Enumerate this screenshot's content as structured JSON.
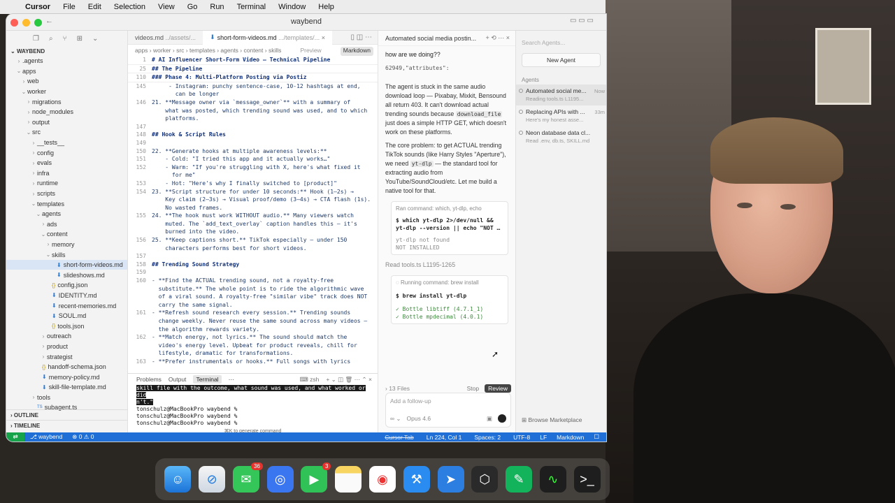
{
  "menubar": {
    "app": "Cursor",
    "items": [
      "File",
      "Edit",
      "Selection",
      "View",
      "Go",
      "Run",
      "Terminal",
      "Window",
      "Help"
    ]
  },
  "window": {
    "title": "waybend"
  },
  "explorer": {
    "root": "WAYBEND",
    "rows": [
      {
        "label": ".agents",
        "indent": 1,
        "type": "folder",
        "open": false
      },
      {
        "label": "apps",
        "indent": 1,
        "type": "folder",
        "open": true
      },
      {
        "label": "web",
        "indent": 2,
        "type": "folder",
        "open": false
      },
      {
        "label": "worker",
        "indent": 2,
        "type": "folder",
        "open": true
      },
      {
        "label": "migrations",
        "indent": 3,
        "type": "folder",
        "open": false
      },
      {
        "label": "node_modules",
        "indent": 3,
        "type": "folder",
        "open": false
      },
      {
        "label": "output",
        "indent": 3,
        "type": "folder",
        "open": false
      },
      {
        "label": "src",
        "indent": 3,
        "type": "folder",
        "open": true
      },
      {
        "label": "__tests__",
        "indent": 4,
        "type": "folder",
        "open": false
      },
      {
        "label": "config",
        "indent": 4,
        "type": "folder",
        "open": false
      },
      {
        "label": "evals",
        "indent": 4,
        "type": "folder",
        "open": false
      },
      {
        "label": "infra",
        "indent": 4,
        "type": "folder",
        "open": false
      },
      {
        "label": "runtime",
        "indent": 4,
        "type": "folder",
        "open": false
      },
      {
        "label": "scripts",
        "indent": 4,
        "type": "folder",
        "open": false
      },
      {
        "label": "templates",
        "indent": 4,
        "type": "folder",
        "open": true
      },
      {
        "label": "agents",
        "indent": 5,
        "type": "folder",
        "open": true
      },
      {
        "label": "ads",
        "indent": 6,
        "type": "folder",
        "open": false
      },
      {
        "label": "content",
        "indent": 6,
        "type": "folder",
        "open": true
      },
      {
        "label": "memory",
        "indent": 7,
        "type": "folder",
        "open": false
      },
      {
        "label": "skills",
        "indent": 7,
        "type": "folder",
        "open": true
      },
      {
        "label": "short-form-videos.md",
        "indent": 8,
        "type": "md",
        "selected": true
      },
      {
        "label": "slideshows.md",
        "indent": 8,
        "type": "md"
      },
      {
        "label": "config.json",
        "indent": 7,
        "type": "json"
      },
      {
        "label": "IDENTITY.md",
        "indent": 7,
        "type": "md"
      },
      {
        "label": "recent-memories.md",
        "indent": 7,
        "type": "md"
      },
      {
        "label": "SOUL.md",
        "indent": 7,
        "type": "md"
      },
      {
        "label": "tools.json",
        "indent": 7,
        "type": "json"
      },
      {
        "label": "outreach",
        "indent": 6,
        "type": "folder",
        "open": false
      },
      {
        "label": "product",
        "indent": 6,
        "type": "folder",
        "open": false
      },
      {
        "label": "strategist",
        "indent": 6,
        "type": "folder",
        "open": false
      },
      {
        "label": "handoff-schema.json",
        "indent": 5,
        "type": "json"
      },
      {
        "label": "memory-policy.md",
        "indent": 5,
        "type": "md"
      },
      {
        "label": "skill-file-template.md",
        "indent": 5,
        "type": "md"
      },
      {
        "label": "tools",
        "indent": 4,
        "type": "folder",
        "open": false
      },
      {
        "label": "subagent.ts",
        "indent": 4,
        "type": "ts"
      }
    ],
    "outline": "OUTLINE",
    "timeline": "TIMELINE"
  },
  "editor": {
    "tabs": [
      {
        "label": "videos.md",
        "path": "../assets/..."
      },
      {
        "label": "short-form-videos.md",
        "path": ".../templates/..."
      }
    ],
    "breadcrumb": [
      "apps",
      "worker",
      "src",
      "templates",
      "agents",
      "content",
      "skills"
    ],
    "preview": "Preview",
    "markdown": "Markdown",
    "lines": [
      {
        "n": "1",
        "t": "# AI Influencer Short-Form Video — Technical Pipeline",
        "cls": "h"
      },
      {
        "n": "25",
        "t": "## The Pipeline",
        "cls": "h"
      },
      {
        "n": "110",
        "t": "### Phase 4: Multi-Platform Posting via Postiz",
        "cls": "h"
      },
      {
        "n": "145",
        "t": "     - Instagram: punchy sentence-case, 10-12 hashtags at end,",
        "cls": ""
      },
      {
        "n": "",
        "t": "       can be longer",
        "cls": ""
      },
      {
        "n": "146",
        "t": "21. **Message owner via `message_owner`** with a summary of",
        "cls": ""
      },
      {
        "n": "",
        "t": "    what was posted, which trending sound was used, and to which",
        "cls": ""
      },
      {
        "n": "",
        "t": "    platforms.",
        "cls": ""
      },
      {
        "n": "147",
        "t": "",
        "cls": ""
      },
      {
        "n": "148",
        "t": "## Hook & Script Rules",
        "cls": "h"
      },
      {
        "n": "149",
        "t": "",
        "cls": ""
      },
      {
        "n": "150",
        "t": "22. **Generate hooks at multiple awareness levels:**",
        "cls": ""
      },
      {
        "n": "151",
        "t": "    - Cold: \"I tried this app and it actually works…\"",
        "cls": ""
      },
      {
        "n": "152",
        "t": "    - Warm: \"If you're struggling with X, here's what fixed it",
        "cls": ""
      },
      {
        "n": "",
        "t": "      for me\"",
        "cls": ""
      },
      {
        "n": "153",
        "t": "    - Hot: \"Here's why I finally switched to [product]\"",
        "cls": ""
      },
      {
        "n": "154",
        "t": "23. **Script structure for under 10 seconds:** Hook (1–2s) →",
        "cls": ""
      },
      {
        "n": "",
        "t": "    Key claim (2–3s) → Visual proof/demo (3–4s) → CTA flash (1s).",
        "cls": ""
      },
      {
        "n": "",
        "t": "    No wasted frames.",
        "cls": ""
      },
      {
        "n": "155",
        "t": "24. **The hook must work WITHOUT audio.** Many viewers watch",
        "cls": ""
      },
      {
        "n": "",
        "t": "    muted. The `add_text_overlay` caption handles this — it's",
        "cls": ""
      },
      {
        "n": "",
        "t": "    burned into the video.",
        "cls": ""
      },
      {
        "n": "156",
        "t": "25. **Keep captions short.** TikTok especially — under 150",
        "cls": ""
      },
      {
        "n": "",
        "t": "    characters performs best for short videos.",
        "cls": ""
      },
      {
        "n": "157",
        "t": "",
        "cls": ""
      },
      {
        "n": "158",
        "t": "## Trending Sound Strategy",
        "cls": "h"
      },
      {
        "n": "159",
        "t": "",
        "cls": ""
      },
      {
        "n": "160",
        "t": "- **Find the ACTUAL trending sound, not a royalty-free",
        "cls": ""
      },
      {
        "n": "",
        "t": "  substitute.** The whole point is to ride the algorithmic wave",
        "cls": ""
      },
      {
        "n": "",
        "t": "  of a viral sound. A royalty-free \"similar vibe\" track does NOT",
        "cls": ""
      },
      {
        "n": "",
        "t": "  carry the same signal.",
        "cls": ""
      },
      {
        "n": "161",
        "t": "- **Refresh sound research every session.** Trending sounds",
        "cls": ""
      },
      {
        "n": "",
        "t": "  change weekly. Never reuse the same sound across many videos —",
        "cls": ""
      },
      {
        "n": "",
        "t": "  the algorithm rewards variety.",
        "cls": ""
      },
      {
        "n": "162",
        "t": "- **Match energy, not lyrics.** The sound should match the",
        "cls": ""
      },
      {
        "n": "",
        "t": "  video's energy level. Upbeat for product reveals, chill for",
        "cls": ""
      },
      {
        "n": "",
        "t": "  lifestyle, dramatic for transformations.",
        "cls": ""
      },
      {
        "n": "163",
        "t": "- **Prefer instrumentals or hooks.** Full songs with lyrics",
        "cls": ""
      }
    ]
  },
  "terminal": {
    "tabs": [
      "Problems",
      "Output",
      "Terminal"
    ],
    "shell": "zsh",
    "lines": [
      "skill file with the outcome, what sound was used, and what worked or did",
      "n't.\"",
      "tonschulz@MacBookPro waybend %",
      "tonschulz@MacBookPro waybend %",
      "tonschulz@MacBookPro waybend %"
    ],
    "hint": "⌘K to generate command"
  },
  "chat": {
    "title": "Automated social media postin...",
    "user_msg": "how are we doing??",
    "snippet": "62949,\"attributes\":",
    "p1a": "The agent is stuck in the same audio download loop — Pixabay, Mixkit, Bensound all return 403. It can't download actual trending sounds because",
    "p1code": "download_file",
    "p1b": "just does a simple HTTP GET, which doesn't work on these platforms.",
    "p2a": "The core problem: to get ACTUAL trending TikTok sounds (like Harry Styles \"Aperture\"), we need",
    "p2code": "yt-dlp",
    "p2b": "— the standard tool for extracting audio from YouTube/SoundCloud/etc. Let me build a native tool for that.",
    "cmd1": {
      "meta": "Ran command: which, yt-dlp, echo",
      "cmd": "$ which yt-dlp 2>/dev/null && yt-dlp --version || echo \"NOT …",
      "out1": "yt-dlp not found",
      "out2": "NOT INSTALLED"
    },
    "read": "Read tools.ts L1195-1265",
    "cmd2": {
      "meta": "Running command: brew install",
      "cmd": "$ brew install yt-dlp",
      "out1": "✓ Bottle libtiff (4.7.1_1)",
      "out2": "✓ Bottle mpdecimal (4.0.1)"
    },
    "files": "13 Files",
    "stop": "Stop",
    "review": "Review",
    "placeholder": "Add a follow-up",
    "model": "Opus 4.6"
  },
  "agents": {
    "search": "Search Agents...",
    "new": "New Agent",
    "section": "Agents",
    "items": [
      {
        "title": "Automated social me...",
        "sub": "Reading tools.ts L1195...",
        "time": "Now"
      },
      {
        "title": "Replacing APIs with ...",
        "sub": "Here's my honest asse...",
        "time": "33m"
      },
      {
        "title": "Neon database data cl...",
        "sub": "Read .env, db.ts, SKILL.md",
        "time": ""
      }
    ],
    "marketplace": "Browse Marketplace"
  },
  "status": {
    "branch": "waybend",
    "errors": "0",
    "warnings": "0",
    "cursor_tab": "Cursor Tab",
    "pos": "Ln 224, Col 1",
    "spaces": "Spaces: 2",
    "enc": "UTF-8",
    "eol": "LF",
    "lang": "Markdown"
  },
  "dock": {
    "badges": {
      "messages": "36",
      "facetime": "3"
    }
  }
}
